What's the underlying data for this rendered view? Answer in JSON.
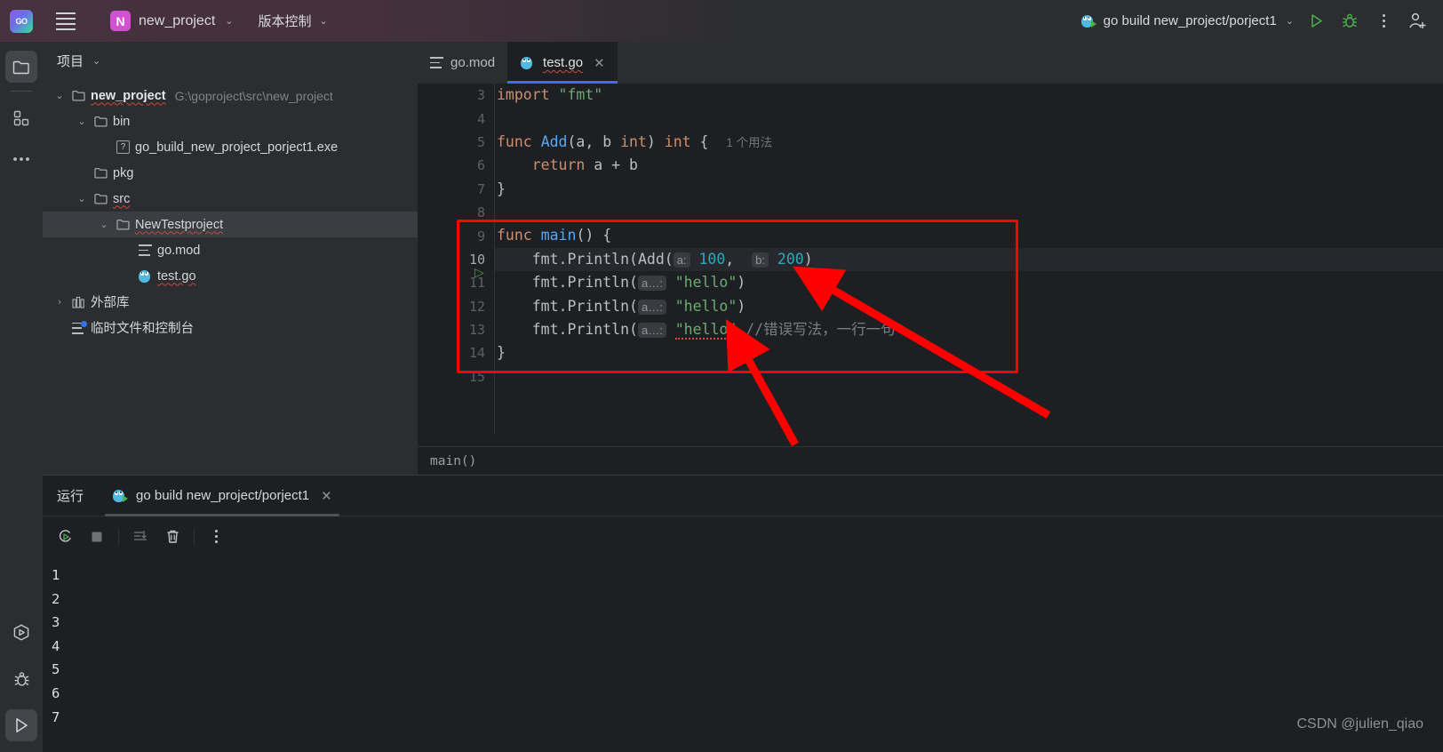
{
  "titlebar": {
    "logo_name": "goland-logo",
    "menu_name": "main-menu",
    "project_badge": "N",
    "project_name": "new_project",
    "vcs_label": "版本控制",
    "run_config": "go build new_project/porject1",
    "run_button": "run-button",
    "debug_button": "debug-button",
    "more_button": "more-actions",
    "account_button": "account-add"
  },
  "rail": {
    "project_icon": "folder-icon",
    "structure_icon": "structure-icon",
    "more_icon": "more-tool-windows",
    "services_icon": "services-icon",
    "debug_icon": "debug-icon",
    "run_icon": "run-icon"
  },
  "project_panel": {
    "title": "项目",
    "tree": [
      {
        "indent": 0,
        "twist": "v",
        "icon": "folder",
        "label": "new_project",
        "bold": true,
        "squiggle": true,
        "path": "G:\\goproject\\src\\new_project",
        "selected": false
      },
      {
        "indent": 1,
        "twist": "v",
        "icon": "folder",
        "label": "bin",
        "bold": false,
        "squiggle": false,
        "path": "",
        "selected": false
      },
      {
        "indent": 2,
        "twist": "",
        "icon": "unknown",
        "label": "go_build_new_project_porject1.exe",
        "bold": false,
        "squiggle": false,
        "path": "",
        "selected": false
      },
      {
        "indent": 1,
        "twist": "",
        "icon": "folder",
        "label": "pkg",
        "bold": false,
        "squiggle": false,
        "path": "",
        "selected": false
      },
      {
        "indent": 1,
        "twist": "v",
        "icon": "folder",
        "label": "src",
        "bold": false,
        "squiggle": true,
        "path": "",
        "selected": false
      },
      {
        "indent": 2,
        "twist": "v",
        "icon": "folder",
        "label": "NewTestproject",
        "bold": false,
        "squiggle": true,
        "path": "",
        "selected": true
      },
      {
        "indent": 3,
        "twist": "",
        "icon": "mod",
        "label": "go.mod",
        "bold": false,
        "squiggle": false,
        "path": "",
        "selected": false
      },
      {
        "indent": 3,
        "twist": "",
        "icon": "go",
        "label": "test.go",
        "bold": false,
        "squiggle": true,
        "path": "",
        "selected": false
      },
      {
        "indent": 0,
        "twist": ">",
        "icon": "library",
        "label": "外部库",
        "bold": false,
        "squiggle": false,
        "path": "",
        "selected": false
      },
      {
        "indent": 0,
        "twist": "",
        "icon": "scratch",
        "label": "临时文件和控制台",
        "bold": false,
        "squiggle": false,
        "path": "",
        "selected": false
      }
    ]
  },
  "editor": {
    "tabs": [
      {
        "label": "go.mod",
        "icon": "mod-icon",
        "active": false,
        "closeable": false
      },
      {
        "label": "test.go",
        "icon": "go-icon",
        "active": true,
        "closeable": true
      }
    ],
    "close_glyph": "✕",
    "first_line_number": 3,
    "line_numbers": [
      3,
      4,
      5,
      6,
      7,
      8,
      9,
      10,
      11,
      12,
      13,
      14,
      15
    ],
    "current_line": 10,
    "run_marker_line": 9,
    "usage_hint": "1 个用法",
    "code": {
      "l3_import": "import",
      "l3_pkg": "\"fmt\"",
      "l5_func": "func",
      "l5_name": "Add",
      "l5_sig": "(a, b ",
      "l5_int1": "int",
      "l5_close": ") ",
      "l5_int2": "int",
      "l5_brace": " {",
      "l6_return": "return",
      "l6_expr": " a + b",
      "l7": "}",
      "l9_func": "func",
      "l9_name": "main",
      "l9_rest": "() {",
      "l10_call": "fmt.Println(Add(",
      "l10_hint_a": "a:",
      "l10_val_a": "100",
      "l10_comma": ", ",
      "l10_hint_b": "b:",
      "l10_val_b": "200",
      "l10_close": ")",
      "l11_call": "fmt.Println(",
      "l11_hint": "a…:",
      "l11_str": "\"hello\"",
      "l11_close": ")",
      "l12_call": "fmt.Println(",
      "l12_hint": "a…:",
      "l12_str": "\"hello\"",
      "l12_close": ")",
      "l13_call": "fmt.Println(",
      "l13_hint": "a…:",
      "l13_str": "\"hello\"",
      "l13_comment": "//错误写法，一行一句",
      "l14": "}"
    },
    "breadcrumb": "main()"
  },
  "run_panel": {
    "label": "运行",
    "tab_label": "go build new_project/porject1",
    "tab_close": "✕",
    "toolbar": {
      "rerun": "rerun-icon",
      "stop": "stop-icon",
      "scroll_end": "scroll-to-end-icon",
      "trash": "clear-all-icon",
      "more": "more-icon"
    },
    "console_lines": [
      "1",
      "2",
      "3",
      "4",
      "5",
      "6",
      "7"
    ]
  },
  "annotations": {
    "box_color": "#ff0000",
    "arrow_color": "#ff0000",
    "watermark": "CSDN @julien_qiao"
  },
  "colors": {
    "bg": "#1e1f22",
    "panel": "#2b2d30",
    "accent": "#3574f0",
    "keyword": "#cf8e6d",
    "string": "#6aab73",
    "function": "#56a8f5",
    "number": "#2aacb8",
    "plain": "#bcbec4",
    "comment": "#7a7e85"
  }
}
